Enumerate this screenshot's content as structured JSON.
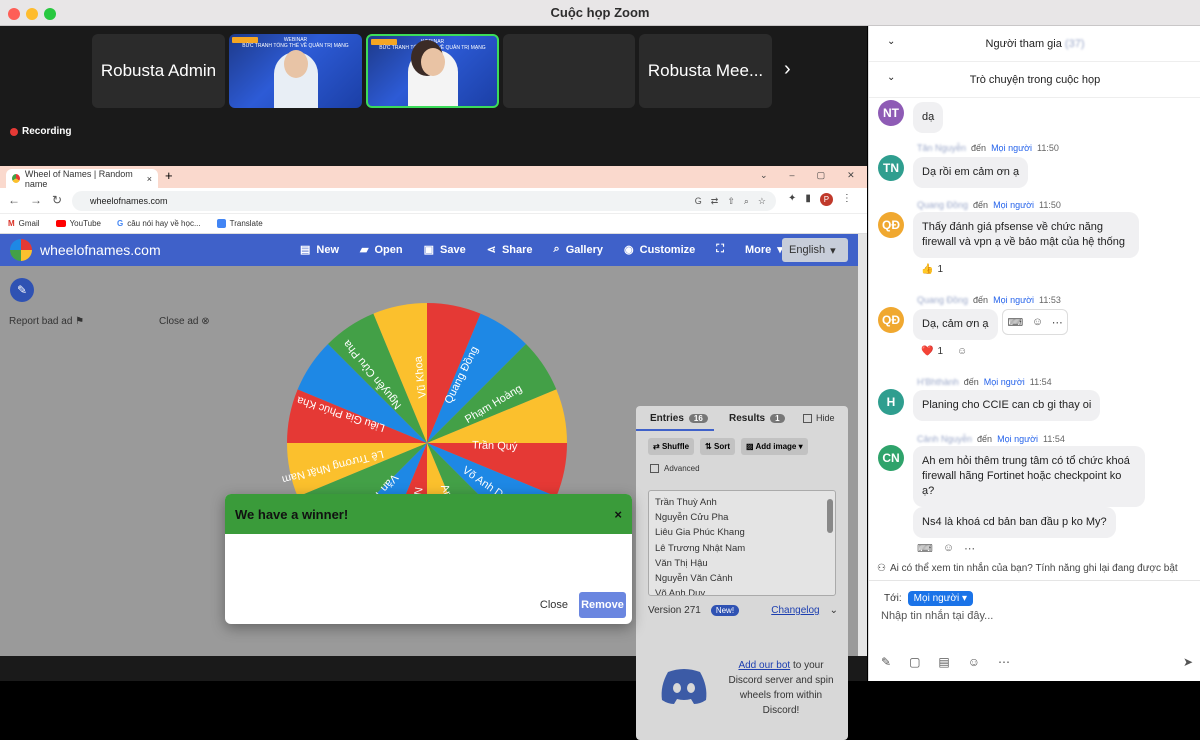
{
  "window": {
    "title": "Cuộc họp Zoom"
  },
  "gallery": {
    "tiles": [
      {
        "name": "Robusta Admin"
      },
      {
        "name": "Robusta Mee..."
      }
    ],
    "video_banner_lines": [
      "WEBINAR",
      "BỨC TRANH TỔNG THỂ VỀ QUẢN TRỊ MẠNG"
    ],
    "video_logo": "Robusta",
    "next_icon": "›",
    "recording_label": "Recording"
  },
  "browser": {
    "tab_title": "Wheel of Names | Random name",
    "new_tab": "+",
    "url": "wheelofnames.com",
    "bookmarks": [
      "Gmail",
      "YouTube",
      "câu nói hay về học...",
      "Translate"
    ],
    "app": {
      "site_name": "wheelofnames.com",
      "nav": [
        "New",
        "Open",
        "Save",
        "Share",
        "Gallery",
        "Customize",
        "More"
      ],
      "language": "English",
      "report_ad": "Report bad ad",
      "close_ad": "Close ad",
      "wheel_labels": [
        "Nguyễn Văn Cảnh",
        "Văn Thị Hậu",
        "Lê Trương Nhật Nam",
        "Liêu Gia Phúc Kha",
        "Nguyễn Cửu Pha",
        "Vũ Khoa",
        "Quang Đồng",
        "Phạm Hoàng",
        "Trần Quý",
        "Võ Anh Duy",
        "Anh"
      ],
      "modal": {
        "title": "We have a winner!",
        "close": "Close",
        "remove": "Remove"
      },
      "panel": {
        "tab_entries": "Entries",
        "entries_count": "16",
        "tab_results": "Results",
        "results_count": "1",
        "hide": "Hide",
        "shuffle": "Shuffle",
        "sort": "Sort",
        "add_image": "Add image",
        "advanced": "Advanced",
        "entries": [
          "Trần Thuỳ Anh",
          "Nguyễn Cửu Pha",
          "Liêu Gia Phúc Khang",
          "Lê Trương Nhật Nam",
          "Văn Thị Hậu",
          "Nguyễn Văn Cảnh",
          "Võ Anh Duy"
        ],
        "version": "Version 271",
        "new_badge": "New!",
        "changelog": "Changelog",
        "discord_link": "Add our bot",
        "discord_text": "to your Discord server and spin wheels from within Discord!"
      }
    }
  },
  "chat": {
    "participants_header": "Người tham gia",
    "participants_count": "(37)",
    "chat_header": "Trò chuyện trong cuộc họp",
    "messages": [
      {
        "initials": "NT",
        "color": "#8e5bb5",
        "text": "dạ"
      },
      {
        "initials": "TN",
        "color": "#2f9e8f",
        "sender": "Tân Nguyễn",
        "to_word": "đến",
        "to": "Mọi người",
        "time": "11:50",
        "text": "Dạ rồi em cảm ơn ạ"
      },
      {
        "initials": "QĐ",
        "color": "#f0a830",
        "sender": "Quang Đồng",
        "to_word": "đến",
        "to": "Mọi người",
        "time": "11:50",
        "text": "Thấy đánh giá pfsense về chức năng firewall và vpn ạ về bảo mật của hệ thống",
        "reaction": "👍",
        "reaction_count": "1"
      },
      {
        "initials": "QĐ",
        "color": "#f0a830",
        "sender": "Quang Đồng",
        "to_word": "đến",
        "to": "Mọi người",
        "time": "11:53",
        "text": "Dạ, cảm ơn ạ",
        "reaction": "❤️",
        "reaction_count": "1"
      },
      {
        "initials": "H",
        "color": "#2f9e8f",
        "sender": "H'Bhthành",
        "to_word": "đến",
        "to": "Mọi người",
        "time": "11:54",
        "text": "Planing cho CCIE can cb gi thay oi"
      },
      {
        "initials": "CN",
        "color": "#2fa36b",
        "sender": "Cảnh Nguyễn",
        "to_word": "đến",
        "to": "Mọi người",
        "time": "11:54",
        "text": "Ah em hỏi thêm trung tâm có tổ chức khoá firewall hãng Fortinet hoặc checkpoint ko ạ?",
        "text2": "Ns4 là khoá cd bản ban đầu p ko My?"
      }
    ],
    "privacy_note": "Ai có thể xem tin nhắn của bạn? Tính năng ghi lại đang được bật",
    "to_label": "Tới:",
    "to_value": "Mọi người",
    "input_placeholder": "Nhập tin nhắn tại đây..."
  }
}
